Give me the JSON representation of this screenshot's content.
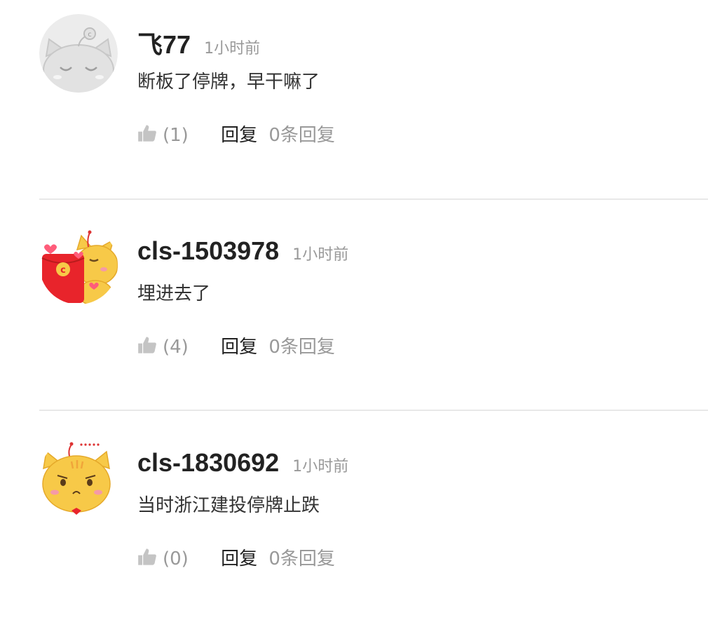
{
  "comments": [
    {
      "username": "飞77",
      "time": "1小时前",
      "content": "断板了停牌，早干嘛了",
      "likes": "(1)",
      "reply_label": "回复",
      "reply_count": "0条回复",
      "avatar_icon": "gray-sleeping-cat-avatar"
    },
    {
      "username": "cls-1503978",
      "time": "1小时前",
      "content": "埋进去了",
      "likes": "(4)",
      "reply_label": "回复",
      "reply_count": "0条回复",
      "avatar_icon": "cat-with-red-envelope-avatar"
    },
    {
      "username": "cls-1830692",
      "time": "1小时前",
      "content": "当时浙江建投停牌止跌",
      "likes": "(0)",
      "reply_label": "回复",
      "reply_count": "0条回复",
      "avatar_icon": "yellow-cat-avatar"
    }
  ],
  "colors": {
    "muted": "#999999",
    "text": "#222222",
    "divider": "#e8e8e8",
    "cat_yellow": "#f7c948",
    "envelope_red": "#e8242b"
  }
}
